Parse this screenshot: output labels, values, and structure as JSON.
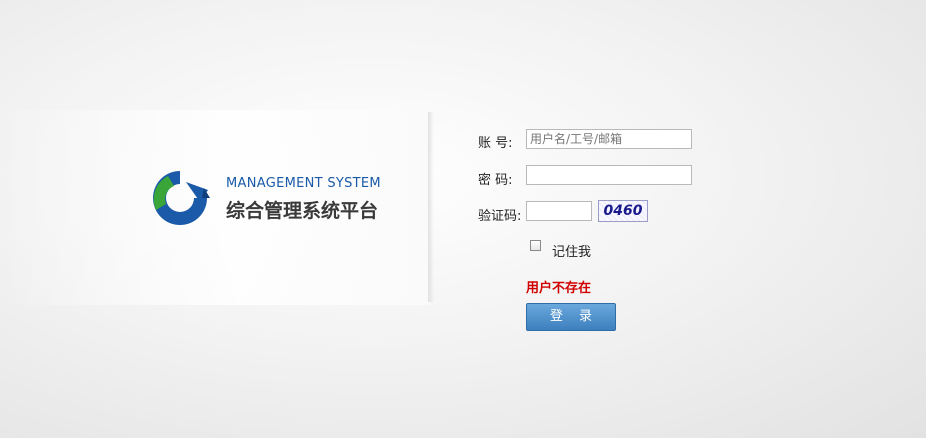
{
  "brand": {
    "title_en": "MANAGEMENT SYSTEM",
    "title_cn": "综合管理系统平台",
    "accent_blue": "#1a5aa8",
    "accent_green": "#2e9a2e",
    "logo_icon": "circular-arrows-logo-icon"
  },
  "form": {
    "account_label": "账   号:",
    "account_placeholder": "用户名/工号/邮箱",
    "password_label": "密   码:",
    "captcha_label": "验证码:",
    "captcha_text": "0460",
    "remember_label": "记住我",
    "error_text": "用户不存在",
    "login_label": "登 录",
    "error_color": "#d10000"
  }
}
